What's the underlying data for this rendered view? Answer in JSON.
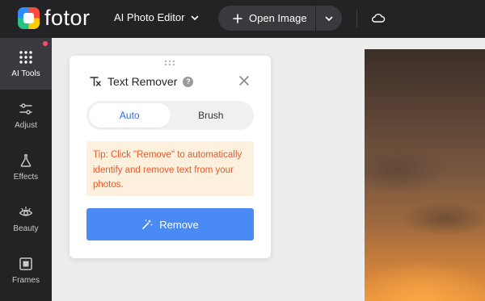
{
  "header": {
    "brand": "fotor",
    "editor_menu": "AI Photo Editor",
    "open_image": "Open Image"
  },
  "sidebar": {
    "items": [
      {
        "label": "AI Tools",
        "icon": "grid-dots-icon",
        "active": true
      },
      {
        "label": "Adjust",
        "icon": "sliders-icon"
      },
      {
        "label": "Effects",
        "icon": "flask-icon"
      },
      {
        "label": "Beauty",
        "icon": "eye-icon"
      },
      {
        "label": "Frames",
        "icon": "frame-icon"
      }
    ]
  },
  "panel": {
    "title": "Text Remover",
    "help": "?",
    "tabs": [
      {
        "label": "Auto",
        "active": true
      },
      {
        "label": "Brush",
        "active": false
      }
    ],
    "tip": "Tip: Click \"Remove\" to automatically identify and remove text from your photos.",
    "remove_label": "Remove"
  },
  "colors": {
    "topbar": "#232326",
    "accent": "#4a8af4",
    "tip_text": "#e45a2e",
    "tip_bg": "#fdf0dc"
  }
}
